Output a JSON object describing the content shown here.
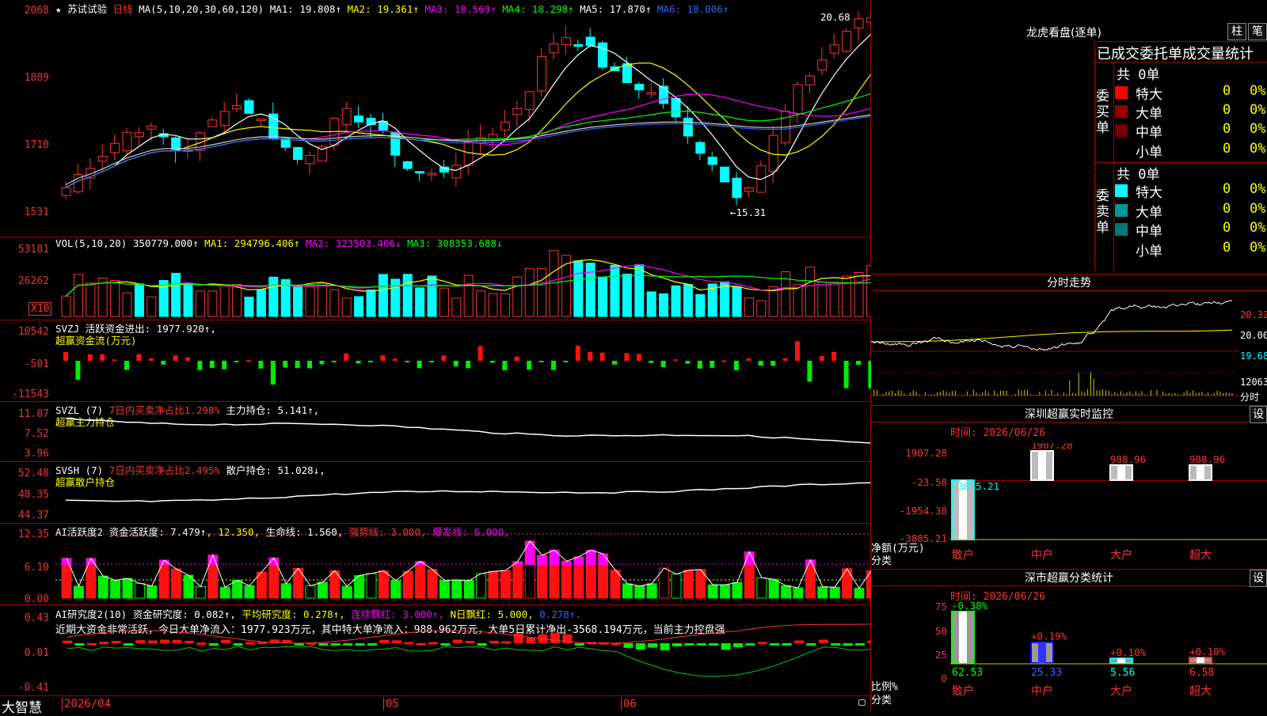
{
  "header": {
    "star": "★",
    "stock_name": "苏试试验",
    "period": "日线",
    "ma_params": "MA(5,10,20,30,60,120)",
    "ma": [
      {
        "label": "MA1: 19.808↑",
        "color": "#ffffff"
      },
      {
        "label": "MA2: 19.361↑",
        "color": "#ffff00"
      },
      {
        "label": "MA3: 18.569↑",
        "color": "#ff00ff"
      },
      {
        "label": "MA4: 18.298↑",
        "color": "#00ff00"
      },
      {
        "label": "MA5: 17.870↑",
        "color": "#dddddd"
      },
      {
        "label": "MA6: 18.006↑",
        "color": "#3366ff"
      }
    ]
  },
  "price_panel": {
    "axis": [
      "2068",
      "1889",
      "1710",
      "1531"
    ],
    "high_label": "20.68",
    "low_label": "←15.31"
  },
  "vol_panel": {
    "title": "VOL(5,10,20)",
    "value": "350779.000↑",
    "ma1": "MA1: 294796.406↑",
    "ma2": "MA2: 323503.406↓",
    "ma3": "MA3: 308353.688↓",
    "axis": [
      "53181",
      "26262"
    ],
    "unit": "X10"
  },
  "svzj_panel": {
    "title": "SVZJ  活跃资金进出: 1977.920↑,",
    "subtitle": "超赢资金流(万元)",
    "axis": [
      "10542",
      "-501",
      "-11543"
    ]
  },
  "svzl_panel": {
    "title1": "SVZL (7)",
    "title2": "7日内买卖净占比1.298%",
    "title3": "主力持仓: 5.141↑,",
    "subtitle": "超赢主力持仓",
    "axis": [
      "11.07",
      "7.52",
      "3.96"
    ]
  },
  "svsh_panel": {
    "title1": "SVSH (7)",
    "title2": "7日内买卖净占比2.495%",
    "title3": "散户持仓: 51.028↓,",
    "subtitle": "超赢散户持仓",
    "axis": [
      "52.48",
      "48.35",
      "44.37"
    ]
  },
  "ai_active_panel": {
    "t1": "AI活跃度2 资金活跃度: 7.479↑",
    "t2": ", 12.350,",
    "t3": "生命线: 1.560,",
    "t4": "强势线: 3.000,",
    "t5": "爆发线: 6.000,",
    "axis": [
      "12.35",
      "6.10",
      "0.00"
    ]
  },
  "ai_research_panel": {
    "t1": "AI研究度2(10) 资金研究度: 0.082↑,",
    "t2": "平均研究度: 0.278↑,",
    "t3": "连续飘红: 3.000↑,",
    "t4": "N日飘红: 5.000,",
    "t5": "0.278↑.",
    "note": "近期大资金非常活跃，今日大单净流入：1977.923万元，其中特大单净流入：988.962万元，大单5日累计净出-3568.194万元，当前主力控盘强",
    "axis": [
      "0.43",
      "0.01",
      "-0.41"
    ]
  },
  "bottom": {
    "brand": "大智慧",
    "dates": [
      "2026/04",
      "05",
      "06"
    ]
  },
  "dragon": {
    "title": "龙虎看盘(逐单)",
    "btn_column": "柱",
    "btn_pen": "笔",
    "tabs_title": "已成交委托单成交量统计",
    "buy_label": "委买单",
    "sell_label": "委卖单",
    "buy_total": "共 0单",
    "sell_total": "共 0单",
    "buy_rows": [
      {
        "label": "特大",
        "v1": "0",
        "v2": "0%",
        "color": "#ff0000"
      },
      {
        "label": "大单",
        "v1": "0",
        "v2": "0%",
        "color": "#990000"
      },
      {
        "label": "中单",
        "v1": "0",
        "v2": "0%",
        "color": "#770000"
      },
      {
        "label": "小单",
        "v1": "0",
        "v2": "0%",
        "color": "#000000"
      }
    ],
    "sell_rows": [
      {
        "label": "特大",
        "v1": "0",
        "v2": "0%",
        "color": "#00ffff"
      },
      {
        "label": "大单",
        "v1": "0",
        "v2": "0%",
        "color": "#009999"
      },
      {
        "label": "中单",
        "v1": "0",
        "v2": "0%",
        "color": "#007777"
      },
      {
        "label": "小单",
        "v1": "0",
        "v2": "0%",
        "color": "#000000"
      }
    ]
  },
  "intraday": {
    "title": "分时走势",
    "axis": [
      "20.32",
      "20.00",
      "19.68"
    ],
    "vol_axis": "12063",
    "vol_label": "分时"
  },
  "sz_monitor": {
    "title": "深圳超赢实时监控",
    "btn": "设",
    "time": "时间: 2026/06/26",
    "axis": [
      "1907.28",
      "-23.58",
      "-1954.38",
      "-3885.21"
    ],
    "ylabel": "净额(万元)",
    "xlabel": "分类",
    "categories": [
      "散户",
      "中户",
      "大户",
      "超大"
    ],
    "values": [
      "-3885.21",
      "1907.28",
      "988.96",
      "988.96"
    ]
  },
  "sz_class": {
    "title": "深市超赢分类统计",
    "btn": "设",
    "time": "时间: 2026/06/26",
    "axis": [
      "75",
      "50",
      "25",
      "0"
    ],
    "ylabel": "比例%",
    "xlabel": "分类",
    "categories": [
      "散户",
      "中户",
      "大户",
      "超大"
    ],
    "values": [
      "62.53",
      "25.33",
      "5.56",
      "6.58"
    ],
    "changes": [
      "-0.38%",
      "+0.19%",
      "+0.10%",
      "+0.10%"
    ]
  },
  "colors": {
    "up": "#ff3333",
    "down": "#00ffff",
    "frame": "#aa0000"
  }
}
